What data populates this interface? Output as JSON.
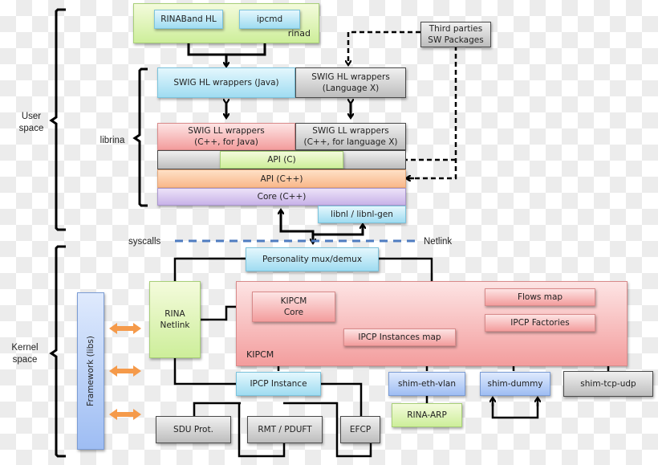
{
  "sections": {
    "user_space": "User\nspace",
    "librina": "librina",
    "kernel_space": "Kernel\nspace",
    "syscalls": "syscalls",
    "netlink": "Netlink"
  },
  "rinad": {
    "container_label": "rinad",
    "rinaband": "RINABand HL",
    "ipcmd": "ipcmd"
  },
  "third_party": "Third parties\nSW Packages",
  "librina_stack": {
    "swig_hl_java": "SWIG HL wrappers (Java)",
    "swig_hl_x": "SWIG HL wrappers\n(Language X)",
    "swig_ll_java": "SWIG LL wrappers\n(C++, for Java)",
    "swig_ll_x": "SWIG LL wrappers\n(C++, for language X)",
    "api_c": "API (C)",
    "api_cpp": "API (C++)",
    "core_cpp": "Core (C++)",
    "libnl": "libnl / libnl-gen"
  },
  "kernel": {
    "personality": "Personality mux/demux",
    "rina_netlink": "RINA\nNetlink",
    "framework": "Framework (libs)",
    "kipcm_container": "KIPCM",
    "kipcm_core": "KIPCM\nCore",
    "flows_map": "Flows map",
    "ipcp_factories": "IPCP Factories",
    "ipcp_instances_map": "IPCP Instances map",
    "ipcp_instance": "IPCP Instance",
    "sdu_prot": "SDU Prot.",
    "rmt_pduft": "RMT / PDUFT",
    "efcp": "EFCP",
    "shim_eth_vlan": "shim-eth-vlan",
    "rina_arp": "RINA-ARP",
    "shim_dummy": "shim-dummy",
    "shim_tcp_udp": "shim-tcp-udp"
  },
  "colors": {
    "solid_line": "#000000",
    "dashed_separator": "#4f7cc0",
    "framework_arrows": "#f59a4a"
  }
}
